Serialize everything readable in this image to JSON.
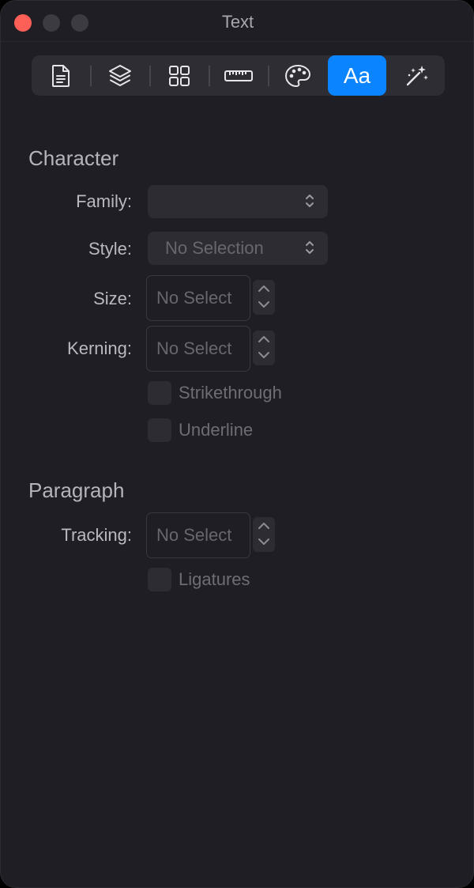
{
  "window": {
    "title": "Text"
  },
  "toolbar": {
    "items": [
      {
        "icon": "document-icon"
      },
      {
        "icon": "layers-icon"
      },
      {
        "icon": "grid-icon"
      },
      {
        "icon": "ruler-icon"
      },
      {
        "icon": "palette-icon"
      },
      {
        "icon": "text-icon",
        "label": "Aa",
        "active": true
      },
      {
        "icon": "magic-wand-icon"
      }
    ],
    "accent_color": "#0a84ff"
  },
  "character": {
    "title": "Character",
    "family": {
      "label": "Family:",
      "value": ""
    },
    "style": {
      "label": "Style:",
      "value": "No Selection"
    },
    "size": {
      "label": "Size:",
      "value": "No Select"
    },
    "kerning": {
      "label": "Kerning:",
      "value": "No Select"
    },
    "strikethrough": {
      "label": "Strikethrough",
      "checked": false
    },
    "underline": {
      "label": "Underline",
      "checked": false
    }
  },
  "paragraph": {
    "title": "Paragraph",
    "tracking": {
      "label": "Tracking:",
      "value": "No Select"
    },
    "ligatures": {
      "label": "Ligatures",
      "checked": false
    }
  }
}
